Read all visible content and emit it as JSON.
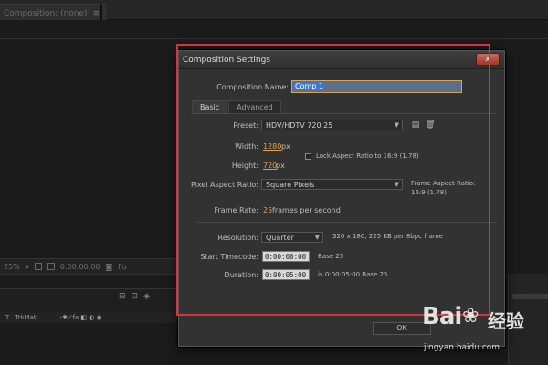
{
  "app": {
    "comp_tab_label": "Composition: (none)",
    "viewer_zoom": "25%",
    "viewer_timecode": "0:00:00:00",
    "viewer_extra": "Fu",
    "trkmat_label": "TrkMat",
    "trkmat_t": "T",
    "switch_icons": "-✱ ⁄ fx ◧ ◐ ◉"
  },
  "dialog": {
    "title": "Composition Settings",
    "close_label": "x",
    "composition_name_label": "Composition Name:",
    "composition_name_value": "Comp 1",
    "tabs": [
      {
        "label": "Basic",
        "active": true
      },
      {
        "label": "Advanced",
        "active": false
      }
    ],
    "preset_label": "Preset:",
    "preset_value": "HDV/HDTV 720 25",
    "width_label": "Width:",
    "width_value": "1280",
    "width_unit": "px",
    "lock_aspect_label": "Lock Aspect Ratio to 16:9 (1.78)",
    "lock_aspect_checked": false,
    "height_label": "Height:",
    "height_value": "720",
    "height_unit": "px",
    "pixel_aspect_label": "Pixel Aspect Ratio:",
    "pixel_aspect_value": "Square Pixels",
    "frame_aspect_label": "Frame Aspect Ratio:",
    "frame_aspect_value": "16:9 (1.78)",
    "frame_rate_label": "Frame Rate:",
    "frame_rate_value": "25",
    "frame_rate_unit": "frames per second",
    "resolution_label": "Resolution:",
    "resolution_value": "Quarter",
    "resolution_info": "320 x 180, 225 KB per 8bpc frame",
    "start_timecode_label": "Start Timecode:",
    "start_timecode_value": "0:00:00:00",
    "start_timecode_base": "Base 25",
    "duration_label": "Duration:",
    "duration_value": "0:00:05:00",
    "duration_info": "is 0:00:05:00  Base 25",
    "ok_label": "OK"
  },
  "watermark": {
    "logo": "Bai",
    "logo_suffix": "经验",
    "url": "jingyan.baidu.com"
  },
  "colors": {
    "accent_value": "#e0a236",
    "highlight_border": "#d7333e",
    "close_button": "#b8463a"
  }
}
